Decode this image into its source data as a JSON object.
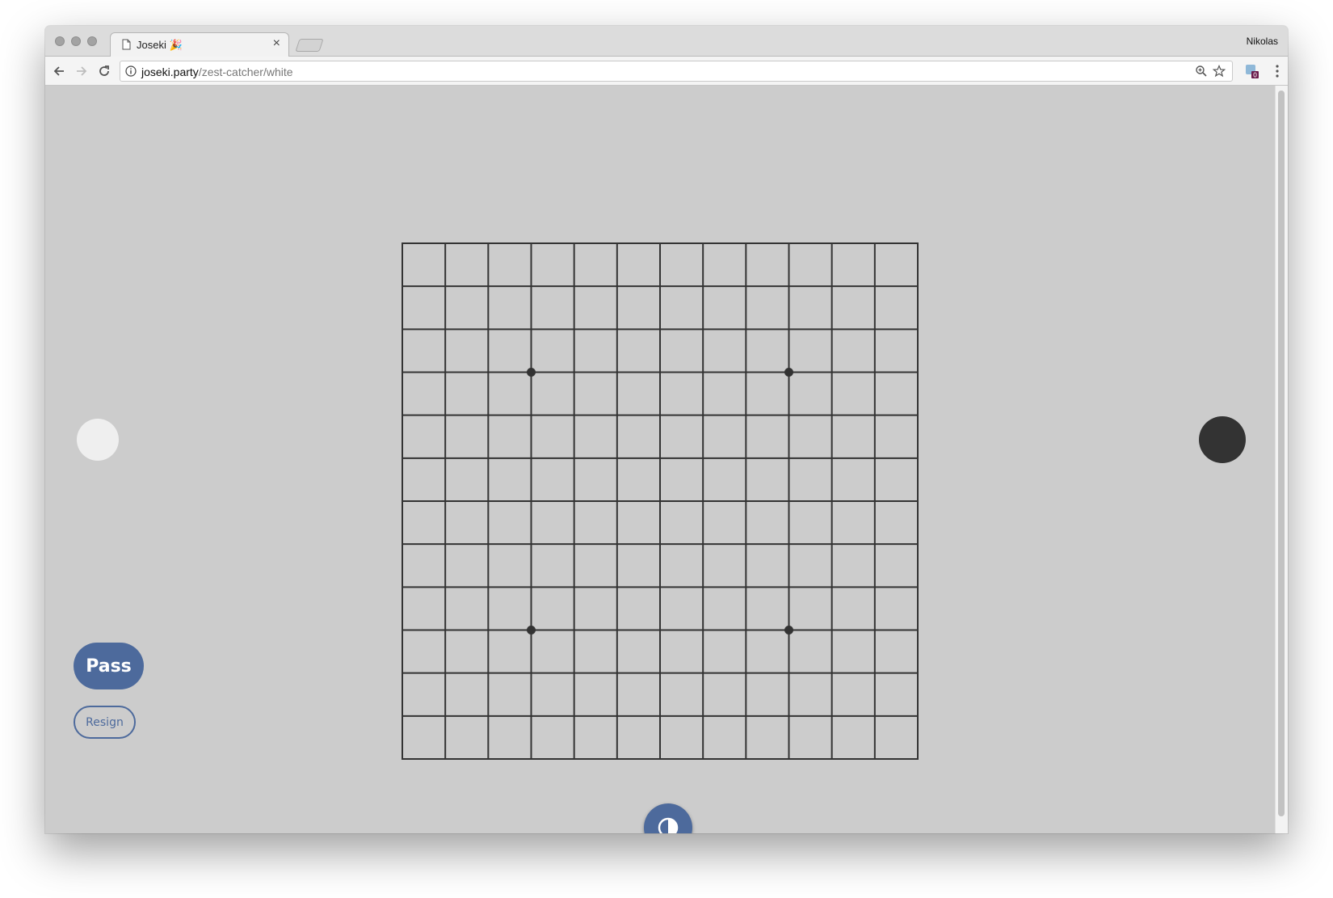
{
  "browser": {
    "tab_title": "Joseki 🎉",
    "tab_close": "×",
    "profile_name": "Nikolas",
    "url_host": "joseki.party",
    "url_path": "/zest-catcher/white",
    "extension_badge": "0"
  },
  "game": {
    "board_size": 13,
    "star_points": [
      [
        3,
        3
      ],
      [
        9,
        3
      ],
      [
        3,
        9
      ],
      [
        9,
        9
      ]
    ],
    "player_white_color": "#efefef",
    "player_black_color": "#333333",
    "pass_label": "Pass",
    "resign_label": "Resign",
    "accent_color": "#4d6a9c",
    "background_color": "#cccccc"
  }
}
